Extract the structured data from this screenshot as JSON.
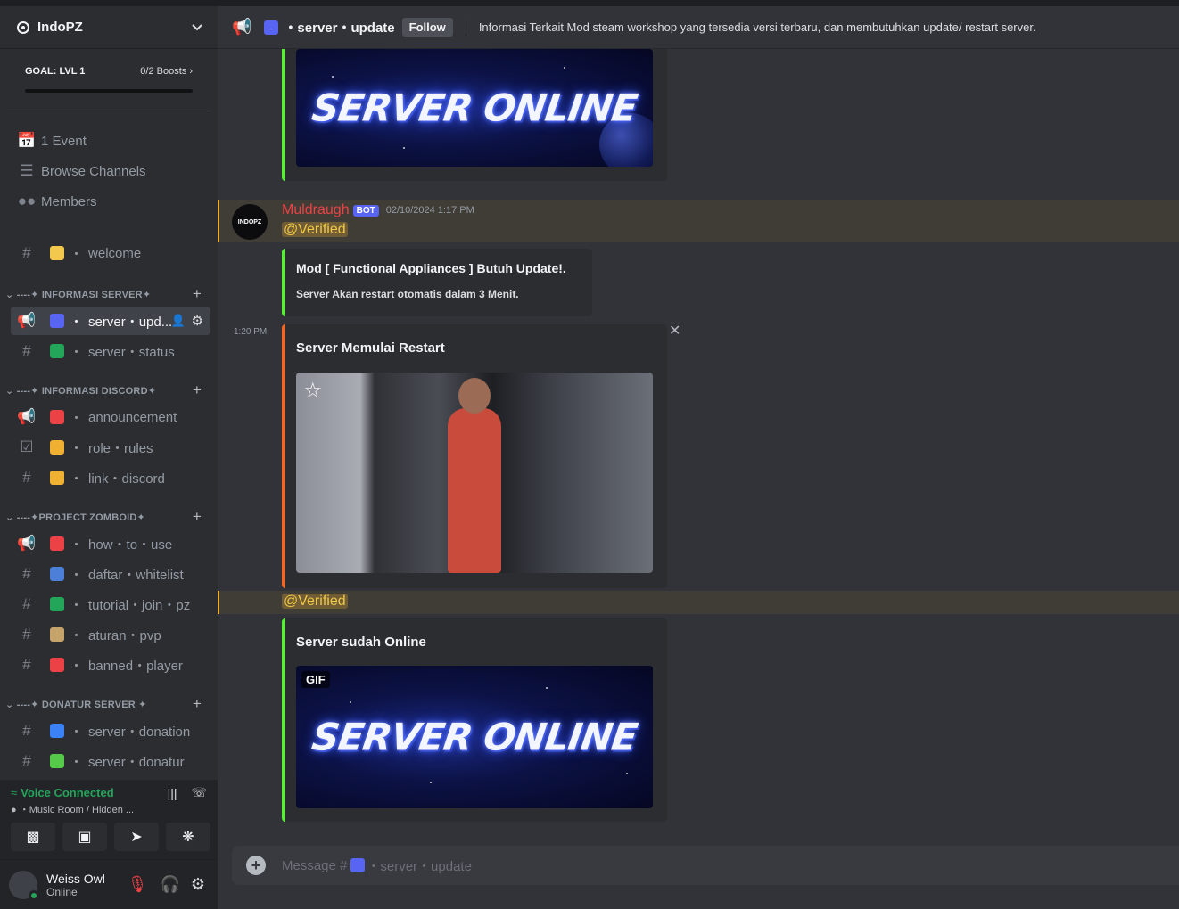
{
  "server": {
    "name": "IndoPZ"
  },
  "goal": {
    "label": "GOAL: LVL 1",
    "boosts": "0/2 Boosts"
  },
  "nav_items": [
    {
      "label": "1 Event"
    },
    {
      "label": "Browse Channels"
    },
    {
      "label": "Members"
    }
  ],
  "channels_top": [
    {
      "name": "welcome",
      "emoji_color": "#f2c94c"
    }
  ],
  "categories": [
    {
      "label": "----✦ INFORMASI SERVER✦"
    },
    {
      "label": "----✦ INFORMASI DISCORD✦"
    },
    {
      "label": "----✦PROJECT ZOMBOID✦"
    },
    {
      "label": "----✦ DONATUR SERVER ✦"
    }
  ],
  "channels": {
    "server_update": "server・upd...",
    "server_status": "server・status",
    "announcement": "announcement",
    "role_rules": "role・rules",
    "link_discord": "link・discord",
    "how_to_use": "how・to・use",
    "daftar_whitelist": "daftar・whitelist",
    "tutorial_join": "tutorial・join・pz",
    "aturan_pvp": "aturan・pvp",
    "banned_player": "banned・player",
    "server_donation": "server・donation",
    "server_donatur": "server・donatur"
  },
  "voice": {
    "status": "Voice Connected",
    "room": "Music Room / Hidden ..."
  },
  "user": {
    "name": "Weiss Owl",
    "status": "Online"
  },
  "header": {
    "channel": "・server・update",
    "follow": "Follow",
    "topic": "Informasi Terkait Mod steam workshop yang tersedia versi terbaru, dan membutuhkan update/ restart server."
  },
  "messages": {
    "author": "Muldraugh",
    "bot_tag": "BOT",
    "timestamp": "02/10/2024 1:17 PM",
    "avatar_text": "INDOPZ",
    "mention": "@Verified",
    "embed1_title": "Mod [ Functional Appliances ] Butuh Update!.",
    "embed1_desc": "Server Akan restart otomatis dalam 3 Menit.",
    "time2": "1:20 PM",
    "embed2_title": "Server Memulai Restart",
    "mention2": "@Verified",
    "embed3_title": "Server sudah Online",
    "gif_badge": "GIF",
    "gif_text": "SERVER ONLINE"
  },
  "composer": {
    "placeholder": "Message #",
    "channel": "・server・update"
  },
  "colors": {
    "accent": "#5865f2",
    "green": "#57f036",
    "orange": "#f26522",
    "mention": "#f0b132",
    "author": "#ed4245"
  }
}
